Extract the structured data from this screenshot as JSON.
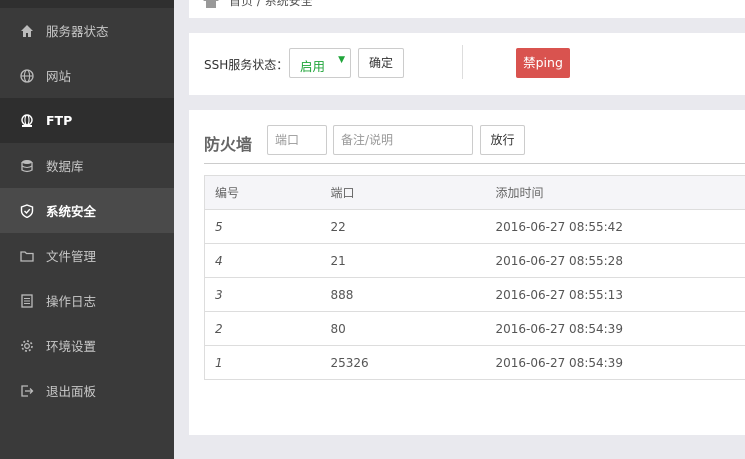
{
  "sidebar": {
    "items": [
      {
        "label": "服务器状态",
        "icon": "home-icon"
      },
      {
        "label": "网站",
        "icon": "globe-icon"
      },
      {
        "label": "FTP",
        "icon": "ftp-icon"
      },
      {
        "label": "数据库",
        "icon": "database-icon"
      },
      {
        "label": "系统安全",
        "icon": "shield-icon"
      },
      {
        "label": "文件管理",
        "icon": "folder-icon"
      },
      {
        "label": "操作日志",
        "icon": "log-icon"
      },
      {
        "label": "环境设置",
        "icon": "gear-icon"
      },
      {
        "label": "退出面板",
        "icon": "logout-icon"
      }
    ]
  },
  "breadcrumb": {
    "text": "首页 / 系统安全"
  },
  "ssh": {
    "label": "SSH服务状态：",
    "status_value": "启用",
    "confirm_label": "确定",
    "ping_label": "禁ping"
  },
  "firewall": {
    "title": "防火墙",
    "port_placeholder": "端口",
    "note_placeholder": "备注/说明",
    "allow_label": "放行",
    "columns": [
      "编号",
      "端口",
      "添加时间"
    ],
    "rows": [
      {
        "id": "5",
        "port": "22",
        "time": "2016-06-27 08:55:42"
      },
      {
        "id": "4",
        "port": "21",
        "time": "2016-06-27 08:55:28"
      },
      {
        "id": "3",
        "port": "888",
        "time": "2016-06-27 08:55:13"
      },
      {
        "id": "2",
        "port": "80",
        "time": "2016-06-27 08:54:39"
      },
      {
        "id": "1",
        "port": "25326",
        "time": "2016-06-27 08:54:39"
      }
    ]
  },
  "colors": {
    "accent_green": "#20a53a",
    "danger": "#d9534f",
    "sidebar_bg": "#3a3a3a"
  }
}
